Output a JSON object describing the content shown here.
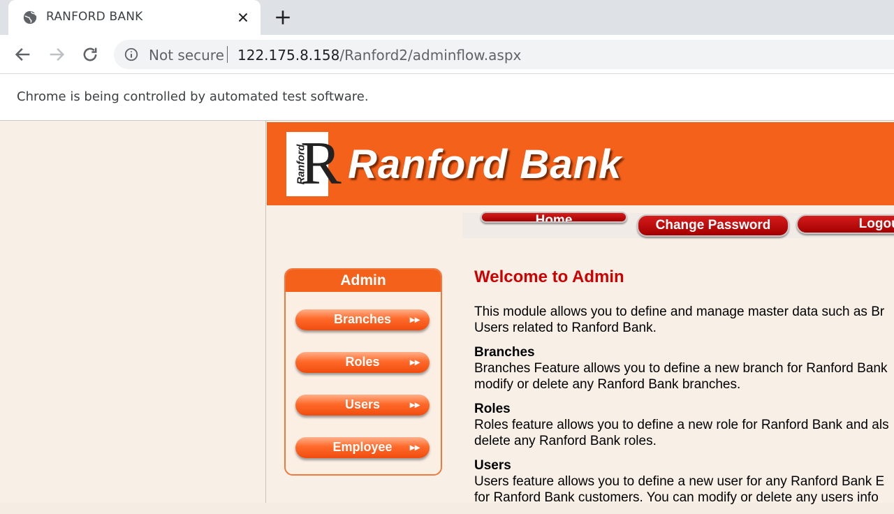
{
  "browser": {
    "tab_title": "RANFORD BANK",
    "security_label": "Not secure",
    "url_host": "122.175.8.158",
    "url_path": "/Ranford2/adminflow.aspx",
    "infobar_text": "Chrome is being controlled by automated test software."
  },
  "header": {
    "logo_side_text": "Ranford",
    "logo_letter": "R",
    "bank_name": "Ranford Bank"
  },
  "topnav": {
    "home_label": "Home",
    "change_password_label": "Change Password",
    "logout_label": "Logout"
  },
  "sidebar": {
    "title": "Admin",
    "items": [
      {
        "label": "Branches"
      },
      {
        "label": "Roles"
      },
      {
        "label": "Users"
      },
      {
        "label": "Employee"
      }
    ]
  },
  "main": {
    "welcome": "Welcome to Admin",
    "intro_line1": "This module allows you to define and manage master data such as Br",
    "intro_line2": "Users related to Ranford Bank.",
    "sections": [
      {
        "title": "Branches",
        "line1": "Branches Feature allows you to define a new branch for Ranford Bank",
        "line2": "modify or delete any Ranford Bank branches."
      },
      {
        "title": "Roles",
        "line1": "Roles feature allows you to define a new role for Ranford Bank and als",
        "line2": "delete any Ranford Bank roles."
      },
      {
        "title": "Users",
        "line1": "Users feature allows you to define a new user for any Ranford Bank E",
        "line2": "for Ranford Bank customers. You can modify or delete any users info"
      }
    ]
  },
  "colors": {
    "brand_orange": "#f4611b",
    "nav_red": "#b70000",
    "welcome_red": "#cc0000",
    "page_bg": "#f8efe6"
  }
}
